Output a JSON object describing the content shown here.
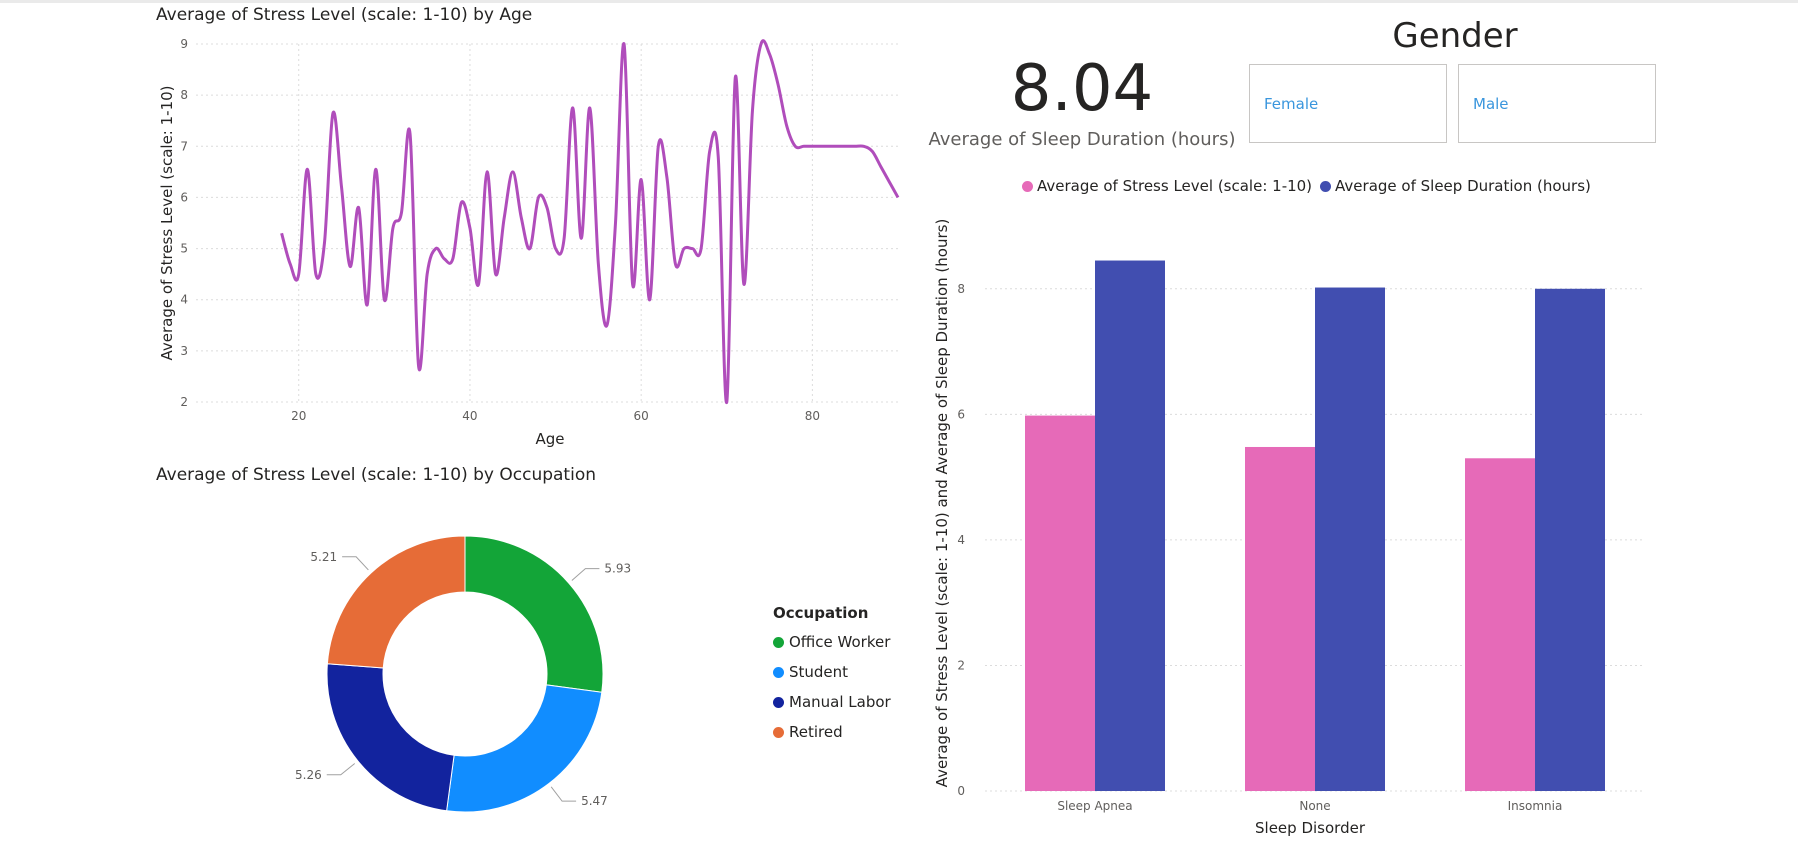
{
  "line_chart": {
    "title": "Average of Stress Level (scale: 1-10) by Age",
    "xlabel": "Age",
    "ylabel": "Average of Stress Level (scale: 1-10)",
    "x_ticks": [
      "20",
      "40",
      "60",
      "80"
    ],
    "y_ticks": [
      "2",
      "3",
      "4",
      "5",
      "6",
      "7",
      "8",
      "9"
    ],
    "color": "#b04dbb"
  },
  "donut": {
    "title": "Average of Stress Level (scale: 1-10) by Occupation",
    "legend_title": "Occupation"
  },
  "kpi": {
    "value": "8.04",
    "label": "Average of Sleep Duration (hours)"
  },
  "slicer": {
    "title": "Gender",
    "options": [
      "Female",
      "Male"
    ]
  },
  "bar_chart": {
    "xlabel": "Sleep Disorder",
    "ylabel": "Average of Stress Level (scale: 1-10) and Average of Sleep Duration (hours)",
    "y_ticks": [
      "0",
      "2",
      "4",
      "6",
      "8"
    ]
  },
  "chart_data": [
    {
      "type": "line",
      "title": "Average of Stress Level (scale: 1-10) by Age",
      "xlabel": "Age",
      "ylabel": "Average of Stress Level (scale: 1-10)",
      "xlim": [
        8,
        90
      ],
      "ylim": [
        2,
        9
      ],
      "grid": true,
      "x": [
        18,
        19,
        20,
        21,
        22,
        23,
        24,
        25,
        26,
        27,
        28,
        29,
        30,
        31,
        32,
        33,
        34,
        35,
        36,
        37,
        38,
        39,
        40,
        41,
        42,
        43,
        44,
        45,
        46,
        47,
        48,
        49,
        50,
        51,
        52,
        53,
        54,
        55,
        56,
        57,
        58,
        59,
        60,
        61,
        62,
        63,
        64,
        65,
        66,
        67,
        68,
        69,
        70,
        71,
        72,
        73,
        74,
        75,
        76,
        77,
        78,
        79,
        80,
        81,
        82,
        83,
        84,
        85,
        86,
        87,
        88,
        89,
        90
      ],
      "y": [
        5.3,
        4.7,
        4.5,
        6.55,
        4.5,
        5.1,
        7.65,
        6.2,
        4.65,
        5.8,
        3.9,
        6.55,
        4.0,
        5.4,
        5.7,
        7.25,
        2.7,
        4.5,
        5.0,
        4.8,
        4.8,
        5.9,
        5.4,
        4.3,
        6.5,
        4.5,
        5.6,
        6.5,
        5.6,
        5.0,
        6.0,
        5.8,
        5.0,
        5.2,
        7.75,
        5.2,
        7.75,
        4.7,
        3.5,
        5.5,
        9.0,
        4.3,
        6.35,
        4.0,
        7.0,
        6.4,
        4.7,
        5.0,
        5.0,
        5.0,
        6.9,
        6.8,
        2.0,
        8.35,
        4.3,
        7.7,
        9.0,
        8.8,
        8.2,
        7.4,
        7.0,
        7.0,
        7.0,
        7.0,
        7.0,
        7.0,
        7.0,
        7.0,
        7.0,
        6.9,
        6.6,
        6.3,
        6.0
      ],
      "color": "#b04dbb"
    },
    {
      "type": "pie",
      "title": "Average of Stress Level (scale: 1-10) by Occupation",
      "legend_title": "Occupation",
      "labels": [
        "Office Worker",
        "Student",
        "Manual Labor",
        "Retired"
      ],
      "values": [
        5.93,
        5.47,
        5.26,
        5.21
      ],
      "value_labels": [
        "5.93",
        "5.47",
        "5.26",
        "5.21"
      ],
      "colors": [
        "#13a538",
        "#118dff",
        "#12239e",
        "#e66c37"
      ],
      "donut": true,
      "legend_position": "right"
    },
    {
      "type": "bar",
      "xlabel": "Sleep Disorder",
      "ylabel": "Average of Stress Level (scale: 1-10) and Average of Sleep Duration (hours)",
      "categories": [
        "Sleep Apnea",
        "None",
        "Insomnia"
      ],
      "ylim": [
        0,
        9
      ],
      "grid": true,
      "legend_position": "top",
      "series": [
        {
          "name": "Average of Stress Level (scale: 1-10)",
          "values": [
            5.98,
            5.48,
            5.3
          ],
          "color": "#e66ab8"
        },
        {
          "name": "Average of Sleep Duration (hours)",
          "values": [
            8.45,
            8.02,
            8.0
          ],
          "color": "#414eb0"
        }
      ]
    }
  ]
}
